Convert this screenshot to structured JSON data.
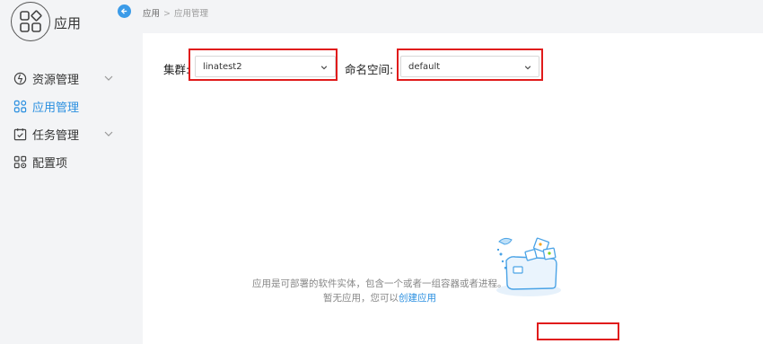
{
  "app": {
    "title": "应用"
  },
  "sidebar": {
    "items": [
      {
        "label": "资源管理",
        "icon": "resource-icon",
        "has_chevron": true,
        "active": false
      },
      {
        "label": "应用管理",
        "icon": "app-grid-icon",
        "has_chevron": false,
        "active": true
      },
      {
        "label": "任务管理",
        "icon": "task-icon",
        "has_chevron": true,
        "active": false
      },
      {
        "label": "配置项",
        "icon": "config-icon",
        "has_chevron": false,
        "active": false
      }
    ]
  },
  "breadcrumb": {
    "root": "应用",
    "separator": ">",
    "current": "应用管理"
  },
  "filters": {
    "cluster": {
      "label": "集群:",
      "value": "linatest2"
    },
    "namespace": {
      "label": "命名空间:",
      "value": "default"
    }
  },
  "empty_state": {
    "description": "应用是可部署的软件实体，包含一个或者一组容器或者进程。",
    "prompt": "暂无应用，您可以",
    "link_label": "创建应用"
  },
  "colors": {
    "accent": "#2a8fe0",
    "highlight": "#e01b1b",
    "background": "#f3f4f6"
  }
}
